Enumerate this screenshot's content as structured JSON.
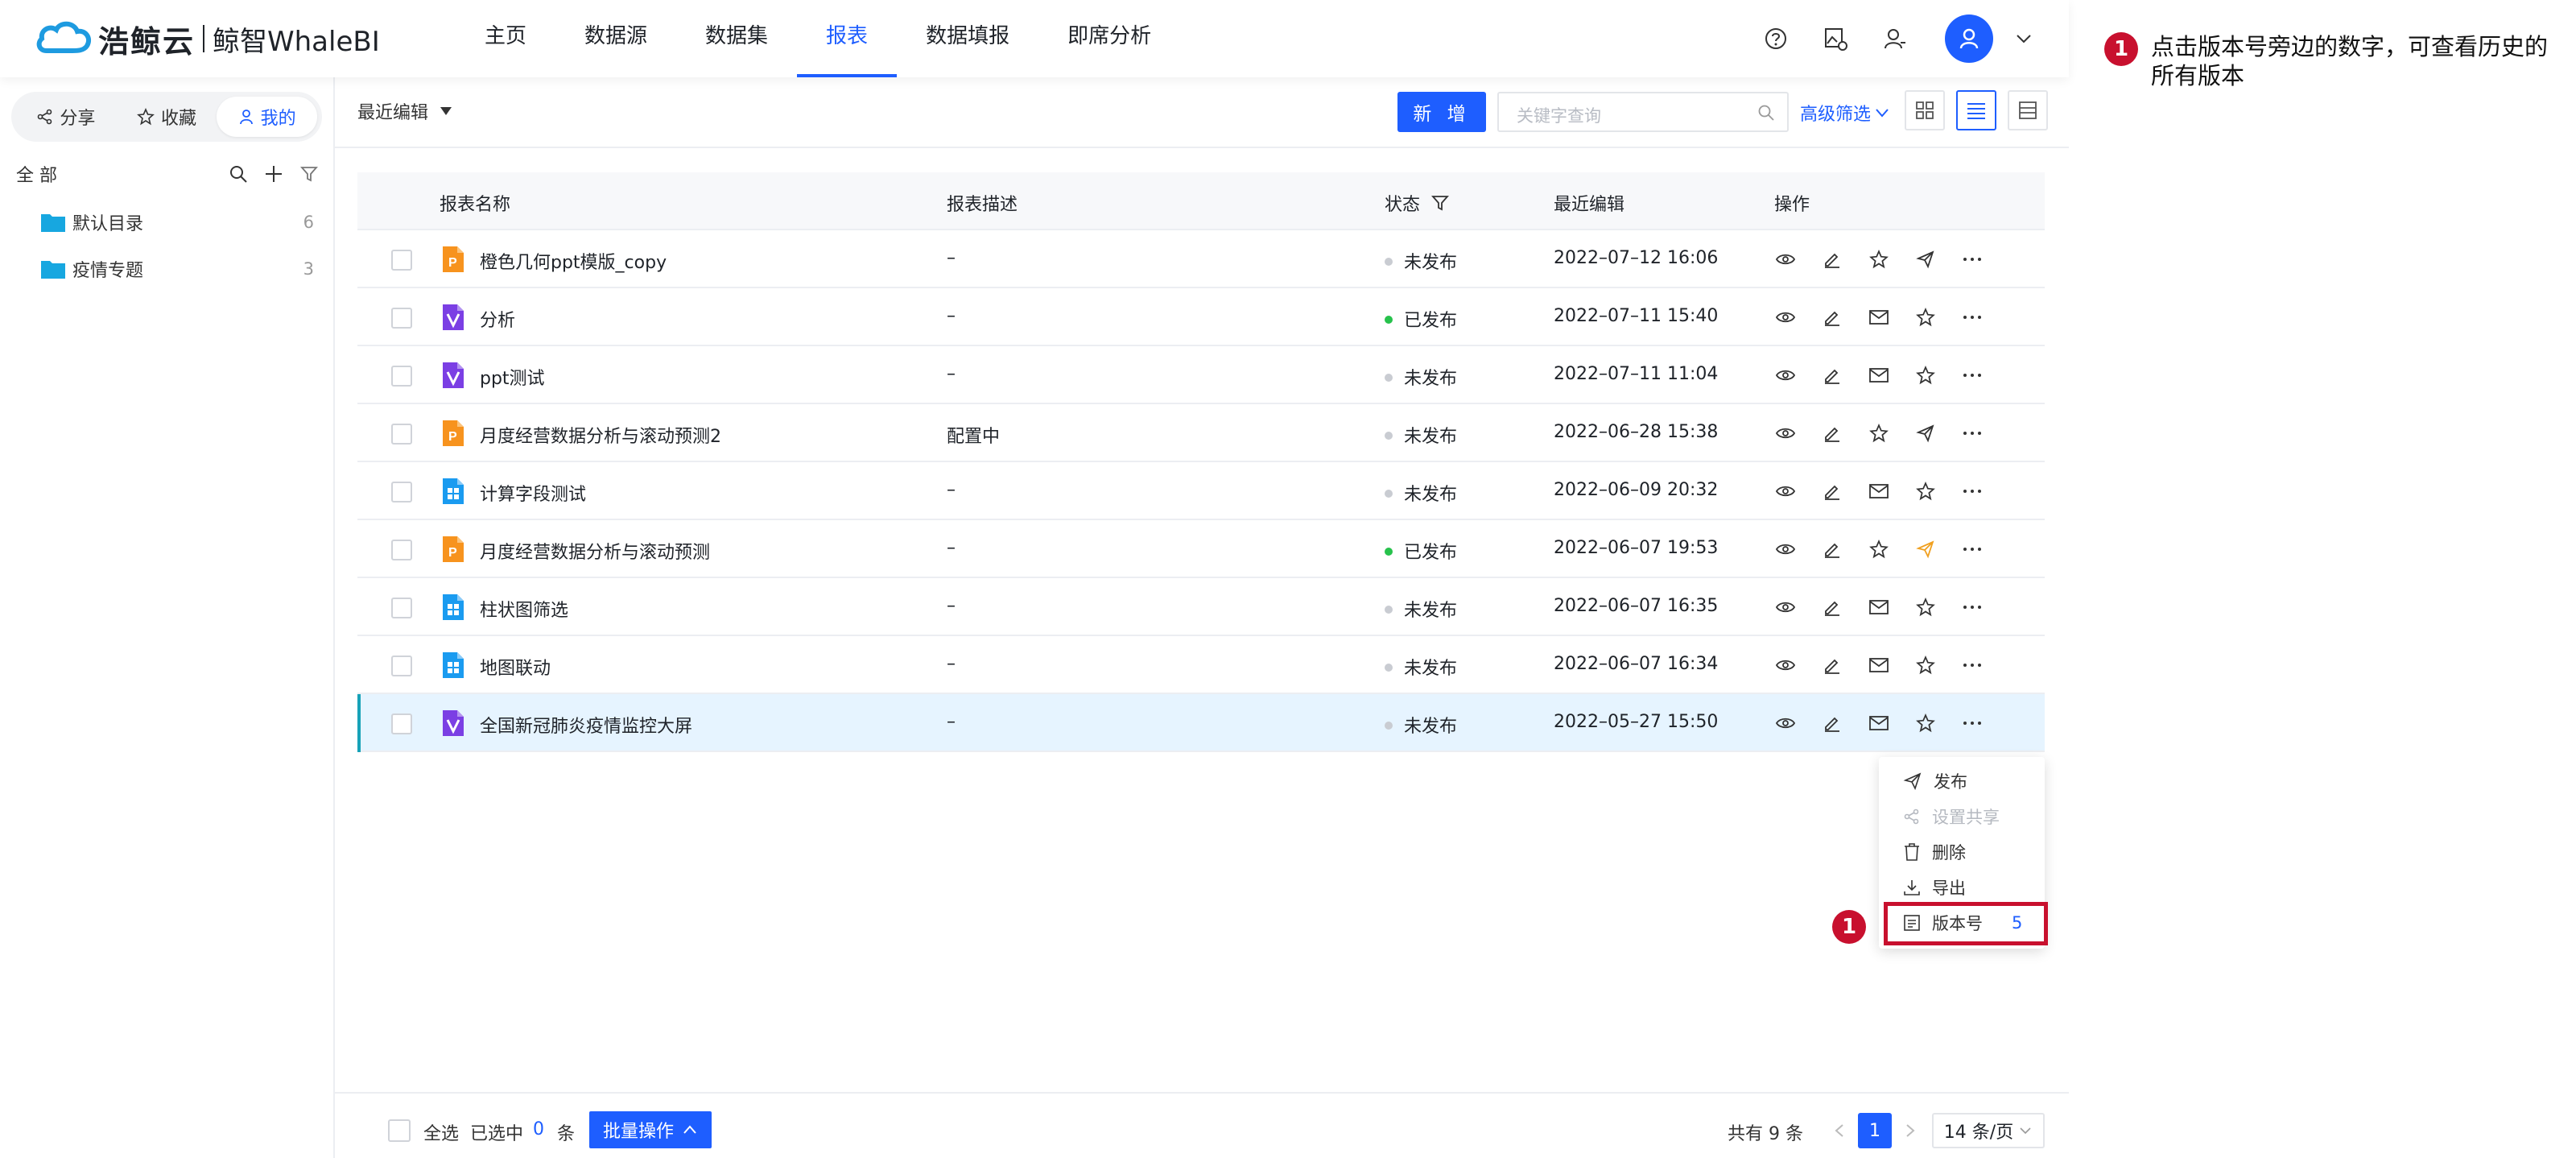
{
  "header": {
    "logo_cn": "浩鲸云",
    "logo_en": "鲸智WhaleBI",
    "nav": [
      "主页",
      "数据源",
      "数据集",
      "报表",
      "数据填报",
      "即席分析"
    ],
    "active_nav": "报表",
    "icons": [
      "help-icon",
      "image-settings-icon",
      "user-switch-icon",
      "user-avatar-icon",
      "chevron-down-icon"
    ]
  },
  "sidebar": {
    "tabs": [
      {
        "label": "分享",
        "icon": "share-icon"
      },
      {
        "label": "收藏",
        "icon": "star-icon"
      },
      {
        "label": "我的",
        "icon": "user-icon"
      }
    ],
    "tree_root": "全 部",
    "folders": [
      {
        "name": "默认目录",
        "count": "6"
      },
      {
        "name": "疫情专题",
        "count": "3"
      }
    ]
  },
  "toolbar": {
    "sort_label": "最近编辑",
    "new_button": "新 增",
    "search_placeholder": "关键字查询",
    "advanced_filter": "高级筛选"
  },
  "table": {
    "headers": {
      "name": "报表名称",
      "desc": "报表描述",
      "status": "状态",
      "edited": "最近编辑",
      "ops": "操作"
    },
    "rows": [
      {
        "type": "ppt",
        "name": "橙色几何ppt模版_copy",
        "desc": "–",
        "status": "未发布",
        "published": false,
        "edited": "2022–07–12 16:06"
      },
      {
        "type": "v",
        "name": "分析",
        "desc": "–",
        "status": "已发布",
        "published": true,
        "edited": "2022–07–11 15:40"
      },
      {
        "type": "v",
        "name": "ppt测试",
        "desc": "–",
        "status": "未发布",
        "published": false,
        "edited": "2022–07–11 11:04"
      },
      {
        "type": "ppt",
        "name": "月度经营数据分析与滚动预测2",
        "desc": "配置中",
        "status": "未发布",
        "published": false,
        "edited": "2022–06–28 15:38"
      },
      {
        "type": "doc",
        "name": "计算字段测试",
        "desc": "–",
        "status": "未发布",
        "published": false,
        "edited": "2022–06–09 20:32"
      },
      {
        "type": "ppt",
        "name": "月度经营数据分析与滚动预测",
        "desc": "–",
        "status": "已发布",
        "published": true,
        "edited": "2022–06–07 19:53"
      },
      {
        "type": "doc",
        "name": "柱状图筛选",
        "desc": "–",
        "status": "未发布",
        "published": false,
        "edited": "2022–06–07 16:35"
      },
      {
        "type": "doc",
        "name": "地图联动",
        "desc": "–",
        "status": "未发布",
        "published": false,
        "edited": "2022–06–07 16:34"
      },
      {
        "type": "v",
        "name": "全国新冠肺炎疫情监控大屏",
        "desc": "–",
        "status": "未发布",
        "published": false,
        "edited": "2022–05–27 15:50"
      }
    ]
  },
  "menu": {
    "items": [
      {
        "label": "发布",
        "icon": "send-icon",
        "disabled": false
      },
      {
        "label": "设置共享",
        "icon": "share-icon",
        "disabled": true
      },
      {
        "label": "删除",
        "icon": "trash-icon",
        "disabled": false
      },
      {
        "label": "导出",
        "icon": "download-icon",
        "disabled": false
      },
      {
        "label": "版本号",
        "icon": "version-icon",
        "disabled": false
      }
    ],
    "version_count": "5"
  },
  "footer": {
    "select_all": "全选",
    "selected_prefix": "已选中",
    "selected_count": "0",
    "selected_suffix": "条",
    "batch_button": "批量操作",
    "total": "共有 9 条",
    "current_page": "1",
    "page_size": "14 条/页"
  },
  "annotation": {
    "badge": "1",
    "text": "点击版本号旁边的数字，可查看历史的所有版本"
  },
  "colors": {
    "primary": "#1e5eff",
    "highlight": "#c8102e",
    "published": "#27c24c",
    "unpublished": "#c9ccd2"
  }
}
